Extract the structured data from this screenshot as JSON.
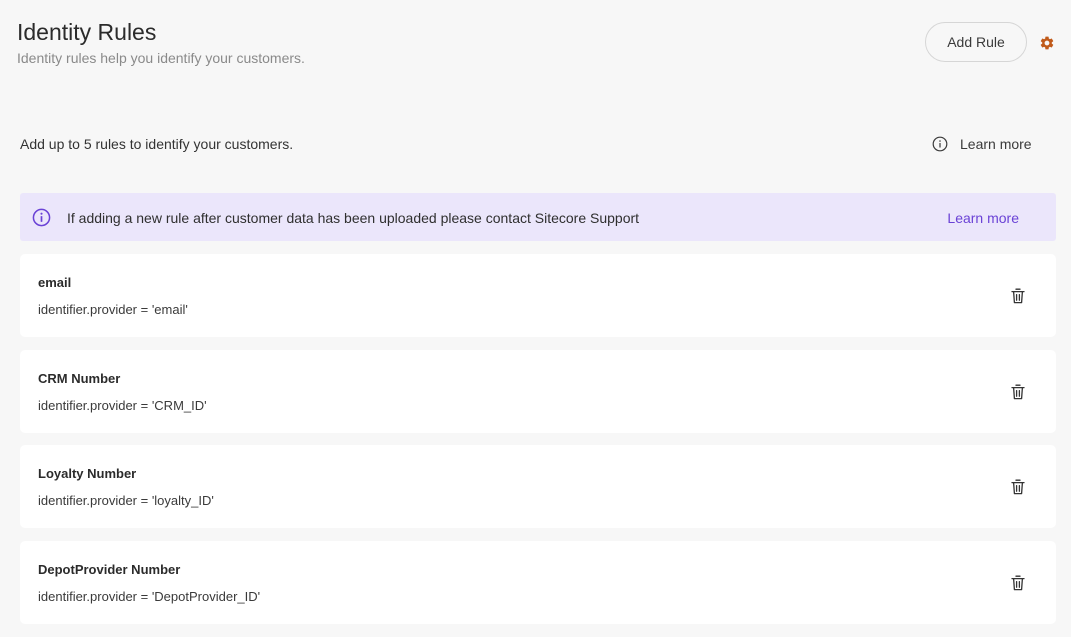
{
  "header": {
    "title": "Identity Rules",
    "subtitle": "Identity rules help you identify your customers.",
    "add_rule_label": "Add Rule",
    "settings_icon": "gear-icon",
    "settings_color": "#c05a1a"
  },
  "intro": {
    "text": "Add up to 5 rules to identify your customers.",
    "learn_more_label": "Learn more",
    "learn_more_icon": "info-icon"
  },
  "banner": {
    "icon": "info-circle-icon",
    "text": "If adding a new rule after customer data has been uploaded please contact Sitecore Support",
    "link_label": "Learn more",
    "background_color": "#ebe6fb",
    "accent_color": "#6a42d6"
  },
  "rules": [
    {
      "name": "email",
      "expression": "identifier.provider = 'email'",
      "delete_icon": "trash-icon"
    },
    {
      "name": "CRM Number",
      "expression": "identifier.provider = 'CRM_ID'",
      "delete_icon": "trash-icon"
    },
    {
      "name": "Loyalty Number",
      "expression": "identifier.provider = 'loyalty_ID'",
      "delete_icon": "trash-icon"
    },
    {
      "name": "DepotProvider Number",
      "expression": "identifier.provider = 'DepotProvider_ID'",
      "delete_icon": "trash-icon"
    }
  ]
}
